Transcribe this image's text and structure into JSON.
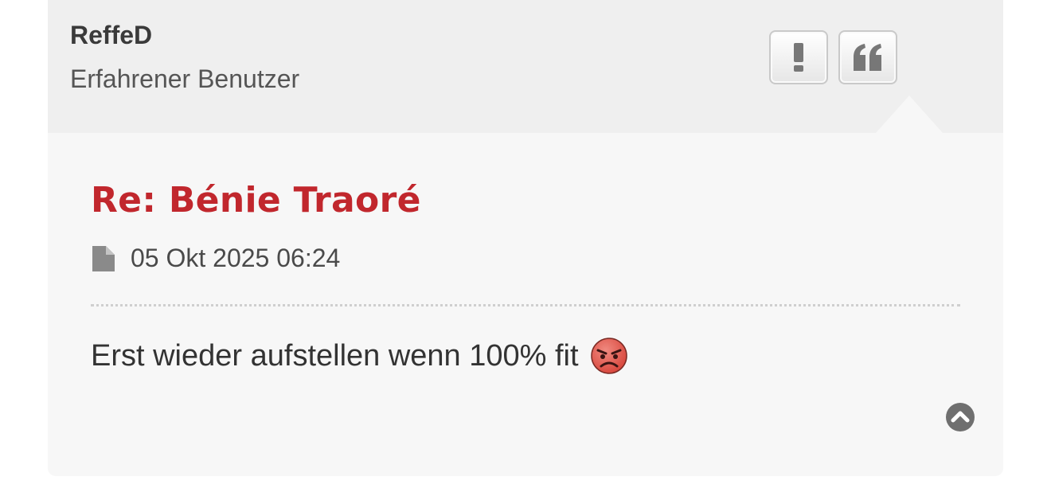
{
  "post": {
    "author": {
      "name": "ReffeD",
      "rank": "Erfahrener Benutzer"
    },
    "actions": {
      "report_icon": "exclamation-icon",
      "quote_icon": "quote-icon"
    },
    "title": "Re: Bénie Traoré",
    "date": "05 Okt 2025 06:24",
    "body_text": "Erst wieder aufstellen wenn 100% fit",
    "body_emoji": "angry-face-emoji",
    "back_to_top_icon": "chevron-up-circle-icon"
  },
  "colors": {
    "title": "#c1272d",
    "header_bg": "#efefef",
    "post_bg": "#f7f7f7",
    "icon_gray": "#777777"
  }
}
